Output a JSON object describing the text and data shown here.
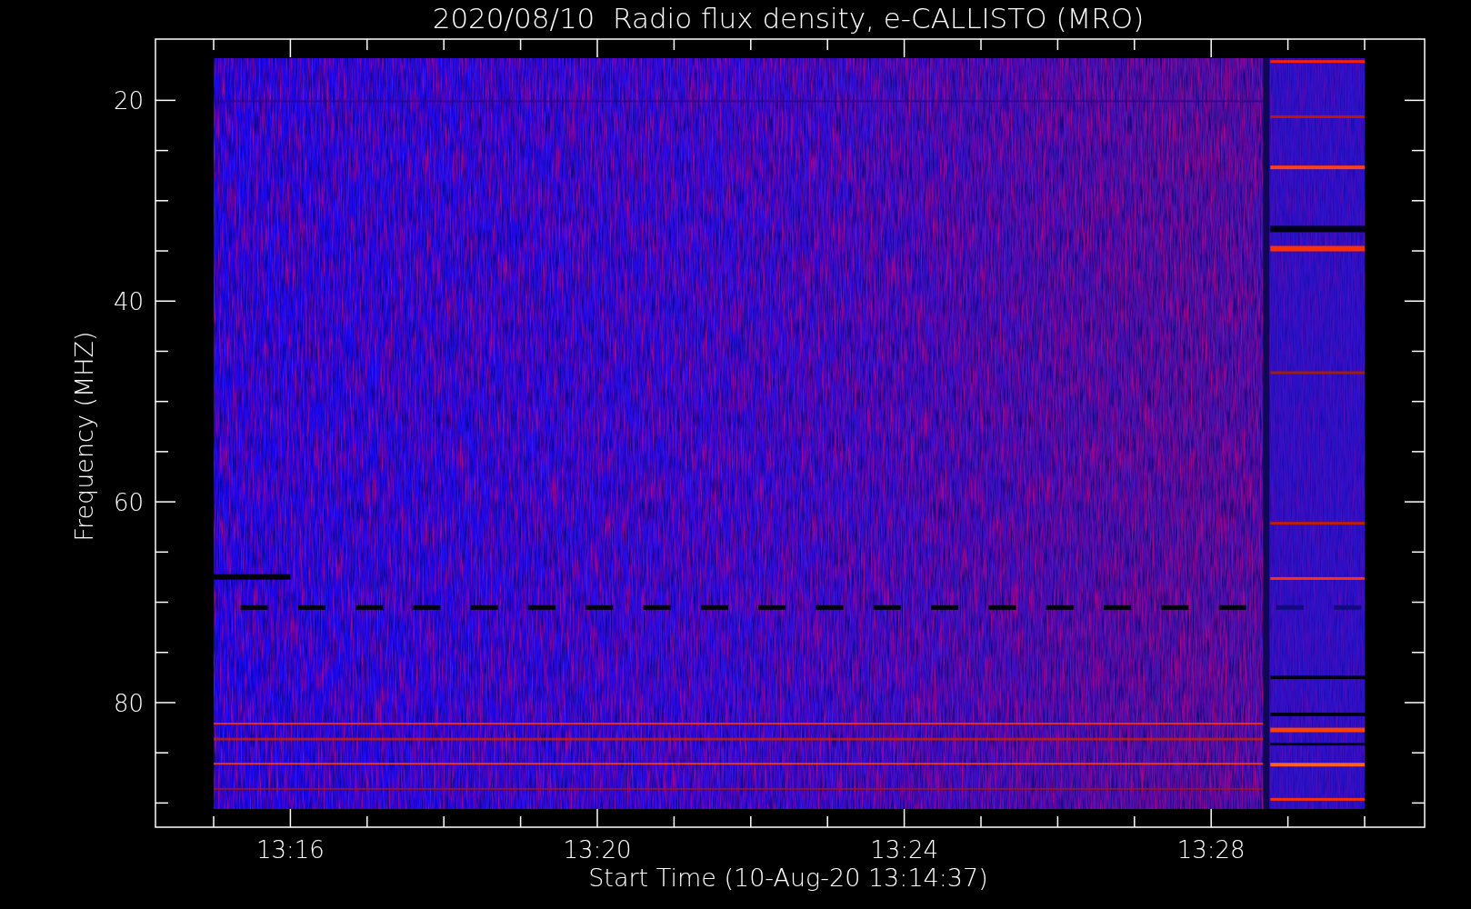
{
  "title": "2020/08/10  Radio flux density, e-CALLISTO (MRO)",
  "x_axis": {
    "label": "Start Time (10-Aug-20 13:14:37)",
    "ticks": [
      "13:16",
      "13:20",
      "13:24",
      "13:28"
    ]
  },
  "y_axis": {
    "label": "Frequency (MHZ)",
    "ticks": [
      "20",
      "40",
      "60",
      "80"
    ]
  }
}
